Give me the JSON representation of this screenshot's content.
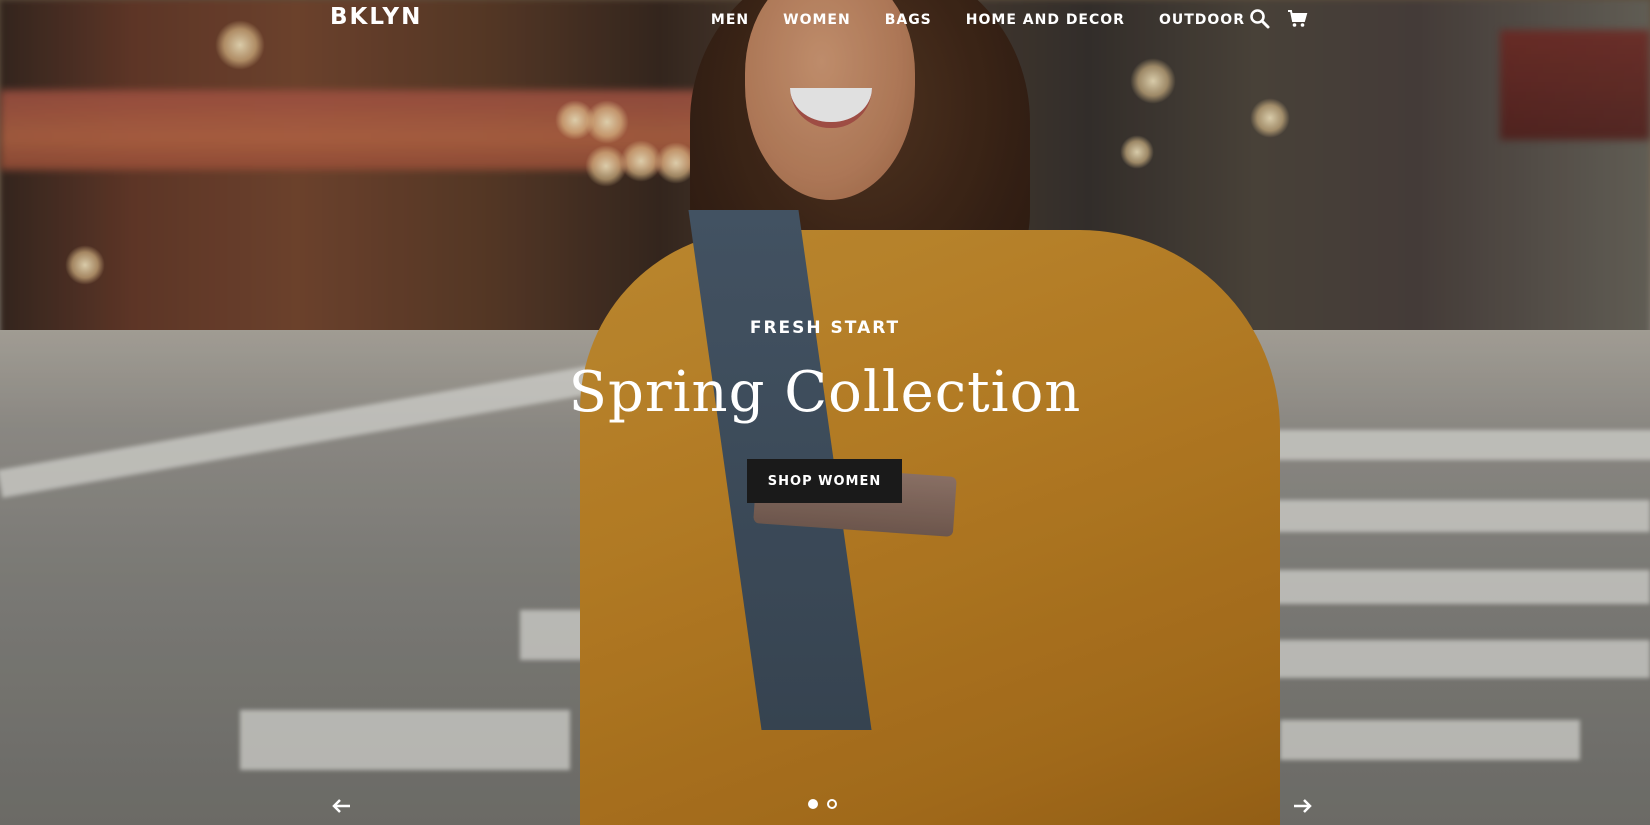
{
  "header": {
    "logo": "BKLYN",
    "nav": [
      {
        "label": "MEN"
      },
      {
        "label": "WOMEN"
      },
      {
        "label": "BAGS"
      },
      {
        "label": "HOME AND DECOR"
      },
      {
        "label": "OUTDOOR"
      }
    ],
    "icons": {
      "search": "search-icon",
      "cart": "cart-icon"
    }
  },
  "hero": {
    "eyebrow": "FRESH START",
    "title": "Spring Collection",
    "cta": "SHOP WOMEN",
    "slide_count": 2,
    "active_slide": 1
  },
  "colors": {
    "text": "#ffffff",
    "button_bg": "#1a1a1a",
    "jacket": "#c98a28"
  }
}
